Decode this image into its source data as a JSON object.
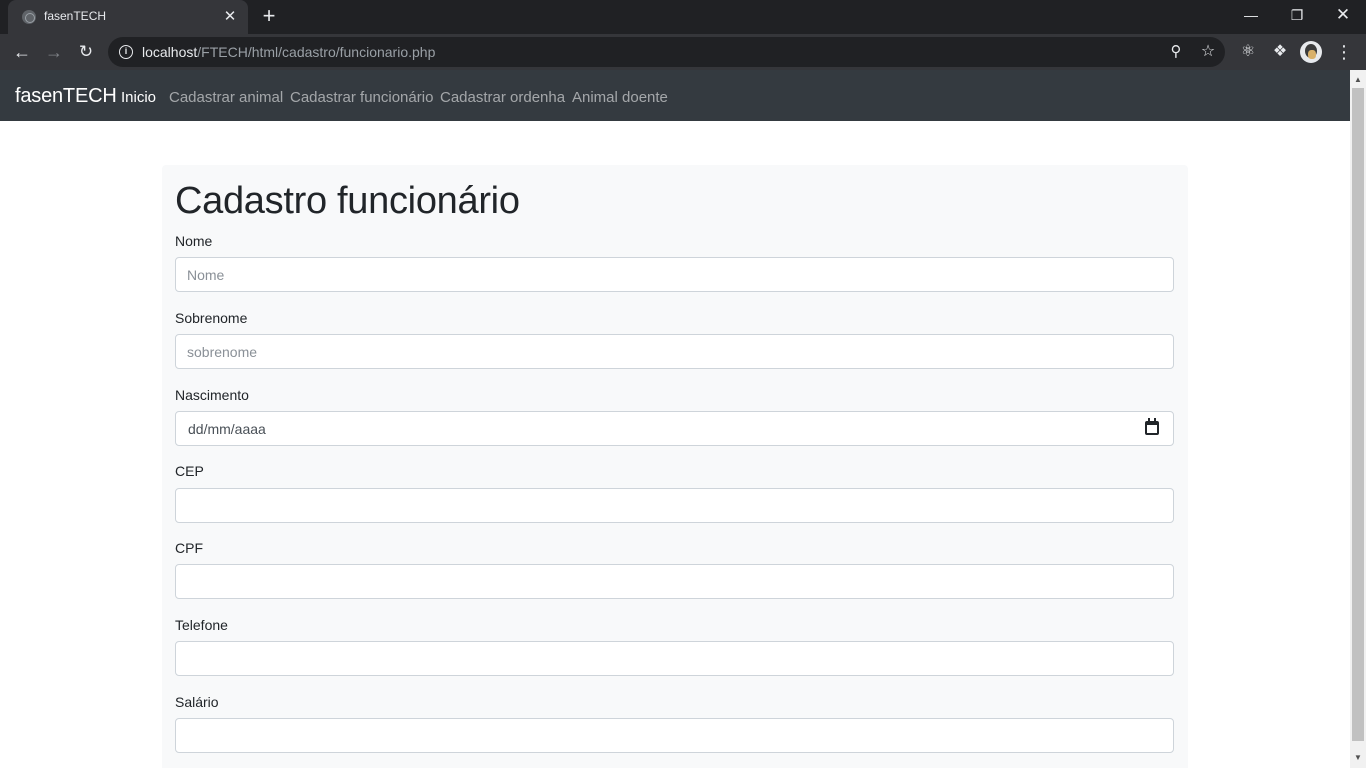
{
  "browser": {
    "tab_title": "fasenTECH",
    "url_host": "localhost",
    "url_path": "/FTECH/html/cadastro/funcionario.php"
  },
  "navbar": {
    "brand": "fasenTECH",
    "links": [
      {
        "label": "Inicio",
        "active": true
      },
      {
        "label": "Cadastrar animal",
        "active": false
      },
      {
        "label": "Cadastrar funcionário",
        "active": false
      },
      {
        "label": "Cadastrar ordenha",
        "active": false
      },
      {
        "label": "Animal doente",
        "active": false
      }
    ]
  },
  "form": {
    "title": "Cadastro funcionário",
    "fields": [
      {
        "label": "Nome",
        "placeholder": "Nome",
        "value": ""
      },
      {
        "label": "Sobrenome",
        "placeholder": "sobrenome",
        "value": ""
      },
      {
        "label": "Nascimento",
        "placeholder": "",
        "value": "dd/mm/aaaa"
      },
      {
        "label": "CEP",
        "placeholder": "",
        "value": ""
      },
      {
        "label": "CPF",
        "placeholder": "",
        "value": ""
      },
      {
        "label": "Telefone",
        "placeholder": "",
        "value": ""
      },
      {
        "label": "Salário",
        "placeholder": "",
        "value": ""
      }
    ]
  },
  "icons": {
    "tab_favicon": "globe-icon",
    "tab_close": "close-icon",
    "new_tab": "plus-icon",
    "back": "arrow-left-icon",
    "forward": "arrow-right-icon",
    "reload": "reload-icon",
    "site_info": "info-icon",
    "zoom": "zoom-out-icon",
    "bookmark": "star-icon",
    "react_devtools": "react-icon",
    "extensions": "puzzle-icon",
    "menu": "kebab-menu-icon",
    "calendar": "calendar-icon"
  },
  "colors": {
    "navbar_bg": "#343a40",
    "form_bg": "#f8f9fa",
    "chrome_dark": "#202124",
    "chrome_toolbar": "#35363a"
  }
}
